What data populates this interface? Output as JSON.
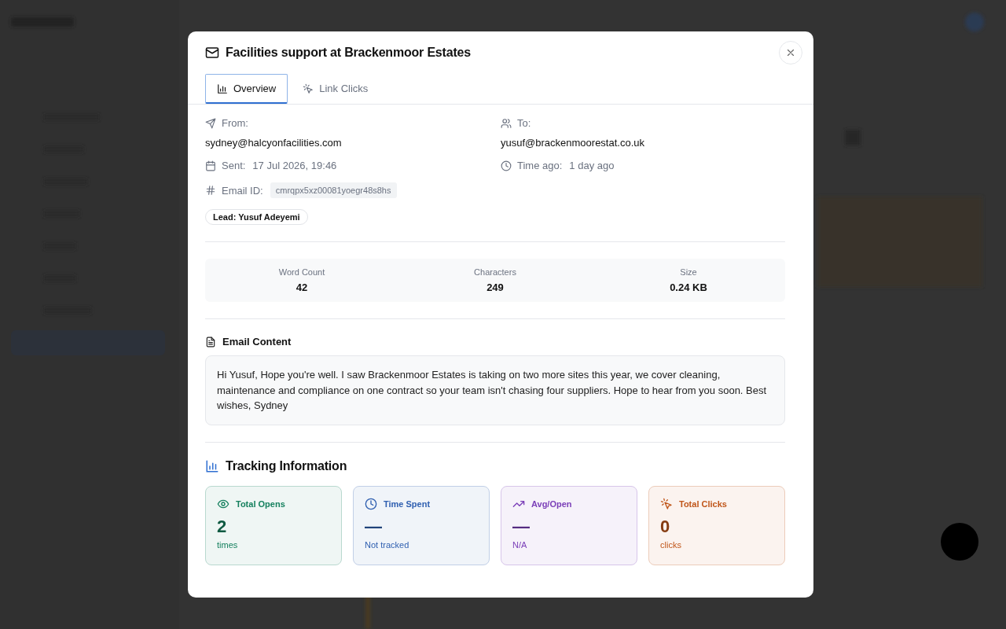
{
  "dialog": {
    "title": "Facilities support at Brackenmoor Estates"
  },
  "tabs": [
    {
      "label": "Overview",
      "selected": true
    },
    {
      "label": "Link Clicks",
      "selected": false
    }
  ],
  "meta": [
    {
      "label": "From:",
      "value": "sydney@halcyonfacilities.com",
      "kind": "stacked"
    },
    {
      "label": "To:",
      "value": "yusuf@brackenmoorestat.co.uk",
      "kind": "stacked"
    },
    {
      "label": "Sent:",
      "value": "17 Jul 2026, 19:46",
      "kind": "inline"
    },
    {
      "label": "Time ago:",
      "value": "1 day ago",
      "kind": "inline"
    },
    {
      "label": "Email ID:",
      "value": "cmrqpx5xz00081yoegr48s8hs",
      "kind": "code"
    }
  ],
  "lead_badge": "Lead: Yusuf Adeyemi",
  "stats": [
    {
      "label": "Word Count",
      "value": "42"
    },
    {
      "label": "Characters",
      "value": "249"
    },
    {
      "label": "Size",
      "value": "0.24 KB"
    }
  ],
  "email_content": {
    "heading": "Email Content",
    "body": "Hi Yusuf, Hope you're well. I saw Brackenmoor Estates is taking on two more sites this year, we cover cleaning, maintenance and compliance on one contract so your team isn't chasing four suppliers. Hope to hear from you soon. Best wishes, Sydney"
  },
  "tracking": {
    "heading": "Tracking Information",
    "cards": [
      {
        "label": "Total Opens",
        "value": "2",
        "unit": "times",
        "color": "#15805e"
      },
      {
        "label": "Time Spent",
        "value": "—",
        "unit": "Not tracked",
        "color": "#2f5fb0"
      },
      {
        "label": "Avg/Open",
        "value": "—",
        "unit": "N/A",
        "color": "#7b3fb8"
      },
      {
        "label": "Total Clicks",
        "value": "0",
        "unit": "clicks",
        "color": "#c0561a"
      }
    ]
  }
}
